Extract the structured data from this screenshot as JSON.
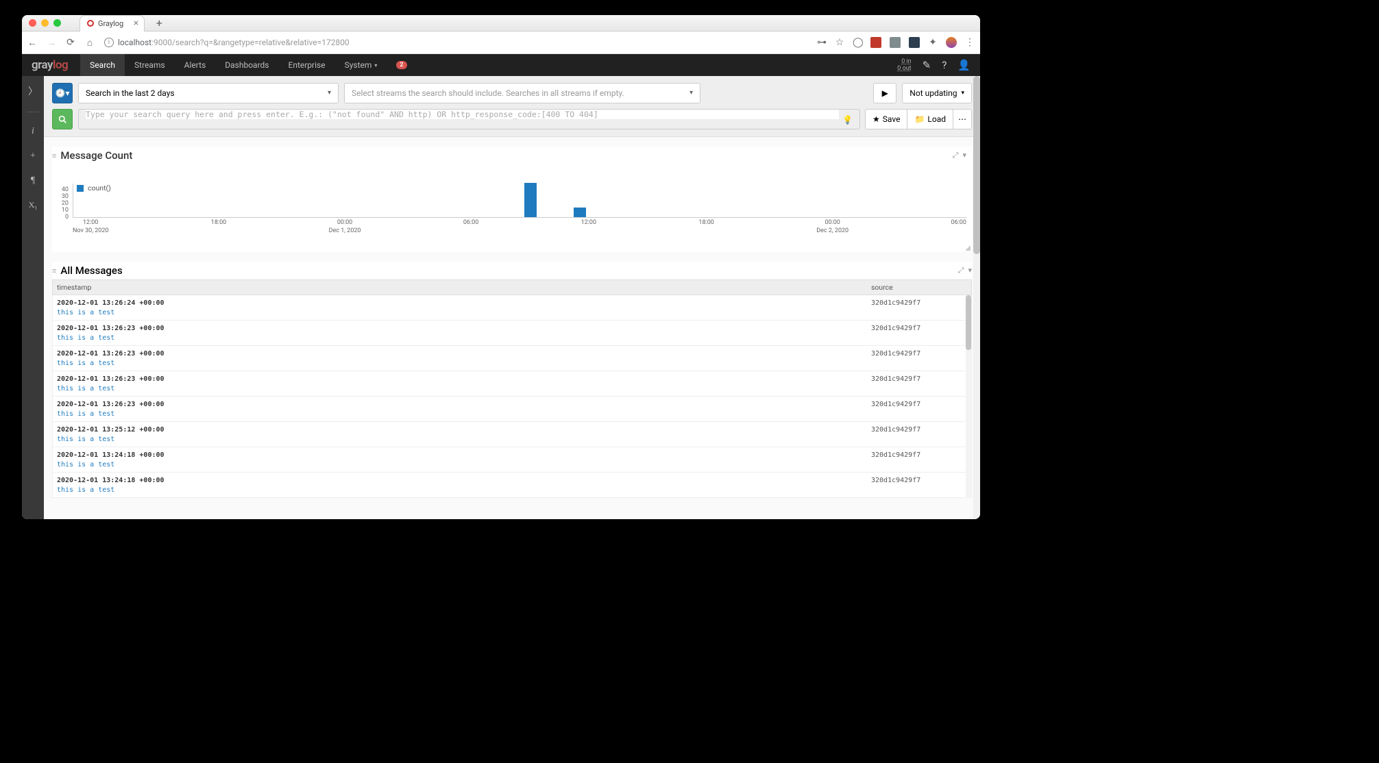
{
  "browser": {
    "tab_title": "Graylog",
    "url_host": "localhost",
    "url_path": ":9000/search?q=&rangetype=relative&relative=172800"
  },
  "header": {
    "nav": [
      "Search",
      "Streams",
      "Alerts",
      "Dashboards",
      "Enterprise",
      "System"
    ],
    "active": "Search",
    "badge": "2",
    "throughput_in": "0 in",
    "throughput_out": "0 out"
  },
  "search": {
    "range_label": "Search in the last 2 days",
    "streams_placeholder": "Select streams the search should include. Searches in all streams if empty.",
    "updating_label": "Not updating",
    "query_placeholder": "Type your search query here and press enter. E.g.: (\"not found\" AND http) OR http_response_code:[400 TO 404]",
    "save_label": "Save",
    "load_label": "Load"
  },
  "chart_panel": {
    "title": "Message Count",
    "legend": "count()"
  },
  "chart_data": {
    "type": "bar",
    "title": "Message Count",
    "ylabel": "",
    "ylim": [
      0,
      40
    ],
    "yticks": [
      0,
      10,
      20,
      30,
      40
    ],
    "x_ticks": [
      {
        "time": "12:00",
        "date": "Nov 30, 2020"
      },
      {
        "time": "18:00",
        "date": ""
      },
      {
        "time": "00:00",
        "date": "Dec 1, 2020"
      },
      {
        "time": "06:00",
        "date": ""
      },
      {
        "time": "12:00",
        "date": ""
      },
      {
        "time": "18:00",
        "date": ""
      },
      {
        "time": "00:00",
        "date": "Dec 2, 2020"
      },
      {
        "time": "06:00",
        "date": ""
      }
    ],
    "series": [
      {
        "name": "count()",
        "color": "#1f7bbf",
        "values": [
          {
            "pos_pct": 50.5,
            "value": 42
          },
          {
            "pos_pct": 56,
            "value": 12
          }
        ]
      }
    ]
  },
  "messages_panel": {
    "title": "All Messages",
    "th_timestamp": "timestamp",
    "th_source": "source"
  },
  "messages": [
    {
      "ts": "2020-12-01 13:26:24 +00:00",
      "src": "320d1c9429f7",
      "body": "this is a test"
    },
    {
      "ts": "2020-12-01 13:26:23 +00:00",
      "src": "320d1c9429f7",
      "body": "this is a test"
    },
    {
      "ts": "2020-12-01 13:26:23 +00:00",
      "src": "320d1c9429f7",
      "body": "this is a test"
    },
    {
      "ts": "2020-12-01 13:26:23 +00:00",
      "src": "320d1c9429f7",
      "body": "this is a test"
    },
    {
      "ts": "2020-12-01 13:26:23 +00:00",
      "src": "320d1c9429f7",
      "body": "this is a test"
    },
    {
      "ts": "2020-12-01 13:25:12 +00:00",
      "src": "320d1c9429f7",
      "body": "this is a test"
    },
    {
      "ts": "2020-12-01 13:24:18 +00:00",
      "src": "320d1c9429f7",
      "body": "this is a test"
    },
    {
      "ts": "2020-12-01 13:24:18 +00:00",
      "src": "320d1c9429f7",
      "body": "this is a test"
    }
  ]
}
